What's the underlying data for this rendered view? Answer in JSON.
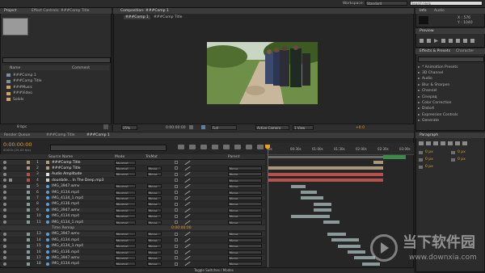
{
  "menu": {
    "workspace_label": "Workspace:",
    "workspace_value": "Standard",
    "search_placeholder": "Search Help"
  },
  "project": {
    "tabs": [
      "Project",
      "Effect Controls: ###Comp Title"
    ],
    "columns": {
      "name": "Name",
      "comment": "Comment"
    },
    "items": [
      {
        "name": "###Comp 1",
        "type": "comp"
      },
      {
        "name": "###Comp Title",
        "type": "comp"
      },
      {
        "name": "###Music",
        "type": "folder"
      },
      {
        "name": "###Video",
        "type": "folder"
      },
      {
        "name": "Solids",
        "type": "folder"
      }
    ],
    "bpc": "8 bpc"
  },
  "composition": {
    "tab": "Composition: ###Comp 1",
    "breadcrumbs": [
      "###Comp 1",
      "###Comp Title"
    ],
    "zoom": "25%",
    "timecode": "0:00:00:00",
    "resolution": "Full",
    "camera": "Active Camera",
    "views": "1 View",
    "exposure": "+0.0"
  },
  "info": {
    "tabs": [
      "Info",
      "Audio"
    ],
    "x": "X : 576",
    "y": "Y : 1040"
  },
  "preview": {
    "title": "Preview"
  },
  "effects": {
    "tabs": [
      "Effects & Presets",
      "Character"
    ],
    "items": [
      "* Animation Presets",
      "3D Channel",
      "Audio",
      "Blur & Sharpen",
      "Channel",
      "Cinepaq",
      "Color Correction",
      "Distort",
      "Expression Controls",
      "Generate"
    ]
  },
  "timeline": {
    "tabs": [
      "Render Queue",
      "###Comp Title",
      "###Comp 1"
    ],
    "timecode": "0:00:00:00",
    "timecode_sub": "00000 (25.00 fps)",
    "columns": {
      "source": "Source Name",
      "mode": "Mode",
      "trkmat": "TrkMat",
      "parent": "Parent"
    },
    "mode_value": "Normal",
    "trkmat_value": "None",
    "parent_value": "None",
    "time_remap_label": "Time Remap",
    "time_remap_value": "0:00:00:00",
    "ruler": [
      "0s",
      "00:30s",
      "01:00s",
      "01:30s",
      "02:00s",
      "02:30s",
      "03:00s"
    ],
    "bottom_label": "Toggle Switches / Modes",
    "layers": [
      {
        "num": "1",
        "name": "###Comp Title",
        "type": "comp",
        "trkmat": false,
        "parent": false
      },
      {
        "num": "2",
        "name": "###Comp Title",
        "type": "comp",
        "trkmat": true,
        "parent": true
      },
      {
        "num": "3",
        "name": "Audio Amplitude",
        "type": "solid",
        "trkmat": true,
        "parent": true
      },
      {
        "num": "4",
        "name": "dounbde... In The Deep.mp3",
        "type": "audio",
        "trkmat": false,
        "parent": true
      },
      {
        "num": "5",
        "name": "IMG_3947.wmv",
        "type": "video",
        "trkmat": true,
        "parent": true
      },
      {
        "num": "6",
        "name": "IMG_4134.mp4",
        "type": "video",
        "trkmat": true,
        "parent": true
      },
      {
        "num": "7",
        "name": "IMG_4134_1.mp4",
        "type": "video",
        "trkmat": true,
        "parent": true
      },
      {
        "num": "8",
        "name": "IMG_4136.mp4",
        "type": "video",
        "trkmat": true,
        "parent": true
      },
      {
        "num": "9",
        "name": "IMG_3947.wmv",
        "type": "video",
        "trkmat": true,
        "parent": true
      },
      {
        "num": "10",
        "name": "IMG_4134.mp4",
        "type": "video",
        "trkmat": true,
        "parent": true
      },
      {
        "num": "11",
        "name": "IMG_4134_1.mp4",
        "type": "video",
        "trkmat": true,
        "parent": true
      },
      {
        "num": "12",
        "name": "Time Remap",
        "type": "remap",
        "trkmat": false,
        "parent": false
      },
      {
        "num": "13",
        "name": "IMG_3947.wmv",
        "type": "video",
        "trkmat": true,
        "parent": true
      },
      {
        "num": "14",
        "name": "IMG_4134.mp4",
        "type": "video",
        "trkmat": true,
        "parent": true
      },
      {
        "num": "15",
        "name": "IMG_4134_1.mp4",
        "type": "video",
        "trkmat": true,
        "parent": true
      },
      {
        "num": "16",
        "name": "IMG_4136.mp4",
        "type": "video",
        "trkmat": true,
        "parent": true
      },
      {
        "num": "17",
        "name": "IMG_3947.wmv",
        "type": "video",
        "trkmat": true,
        "parent": true
      },
      {
        "num": "18",
        "name": "IMG_4134.mp4",
        "type": "video",
        "trkmat": true,
        "parent": true
      }
    ]
  },
  "paragraph": {
    "tabs": [
      "Paragraph"
    ],
    "values": [
      "0 px",
      "0 px",
      "0 px",
      "0 px",
      "0 px"
    ]
  },
  "watermark": {
    "brand": "当下软件园",
    "url": "www.downxia.com"
  },
  "colors": {
    "accent_orange": "#f0a020",
    "label_tan": "#a8977a",
    "label_gray": "#8a9a98",
    "label_red": "#b8514c"
  }
}
